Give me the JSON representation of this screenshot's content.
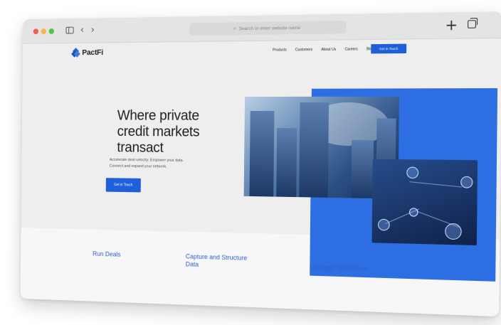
{
  "browser": {
    "address_placeholder": "Search or enter website name",
    "icons": [
      "sidebar-icon",
      "back-icon",
      "forward-icon",
      "search-icon",
      "plus-icon",
      "tabs-icon"
    ]
  },
  "site": {
    "brand": "PactFi",
    "nav": [
      "Products",
      "Customers",
      "About Us",
      "Careers",
      "Blog"
    ],
    "nav_cta": "Get in Touch",
    "hero": {
      "title_lines": [
        "Where private",
        "credit markets",
        "transact"
      ],
      "subtitle_lines": [
        "Accelerate deal velocity. Empower your data.",
        "Connect and expand your network."
      ],
      "cta": "Get in Touch"
    },
    "features": [
      "Run Deals",
      "Capture and Structure Data",
      "Manage Operations"
    ]
  },
  "colors": {
    "accent": "#1f5fd8",
    "panel_blue": "#2d6fe3",
    "feature_text": "#2f5fc8"
  }
}
